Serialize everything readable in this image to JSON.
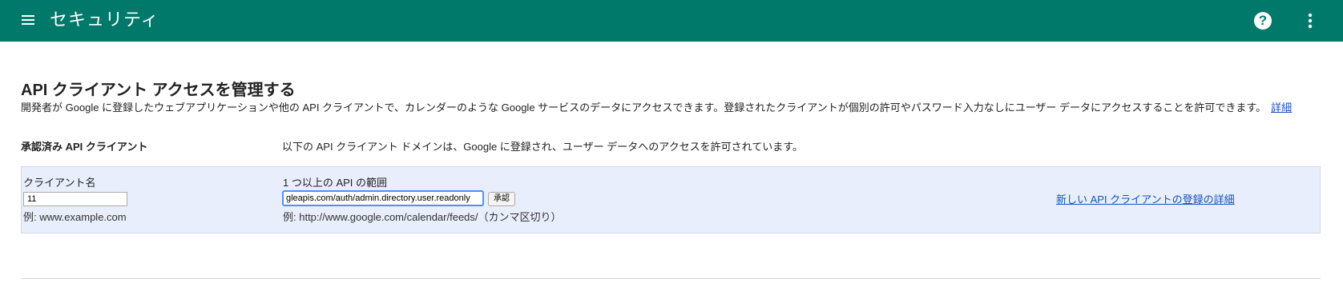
{
  "appbar": {
    "title": "セキュリティ",
    "help_symbol": "?",
    "background": "#00796b"
  },
  "page": {
    "heading": "API クライアント アクセスを管理する",
    "description": "開発者が Google に登録したウェブアプリケーションや他の API クライアントで、カレンダーのような Google サービスのデータにアクセスできます。登録されたクライアントが個別の許可やパスワード入力なしにユーザー データにアクセスすることを許可できます。",
    "details_link": "詳細"
  },
  "section": {
    "label": "承認済み API クライアント",
    "description": "以下の API クライアント ドメインは、Google に登録され、ユーザー データへのアクセスを許可されています。"
  },
  "form": {
    "client_label": "クライアント名",
    "client_value": "11",
    "client_hint": "例: www.example.com",
    "scope_label": "1 つ以上の API の範囲",
    "scope_value": "gleapis.com/auth/admin.directory.user.readonly",
    "scope_hint": "例: http://www.google.com/calendar/feeds/（カンマ区切り）",
    "authorize_button": "承認",
    "register_link": "新しい API クライアントの登録の詳細"
  },
  "colors": {
    "accent": "#00796b",
    "link": "#1a4fbd",
    "panel": "#e8eefb"
  }
}
